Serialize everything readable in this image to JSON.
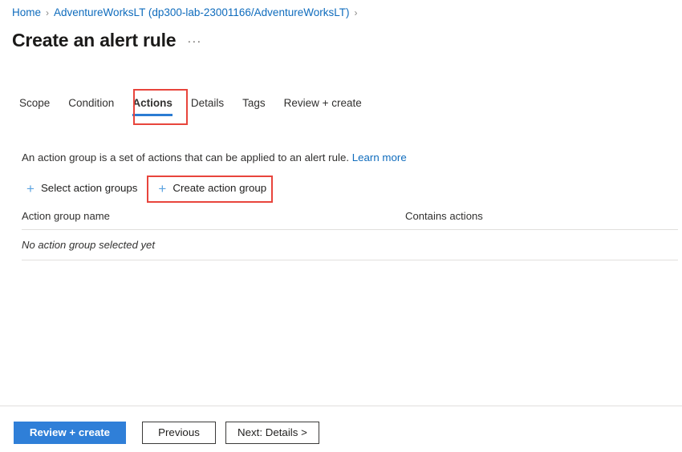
{
  "breadcrumb": {
    "items": [
      {
        "label": "Home"
      },
      {
        "label": "AdventureWorksLT (dp300-lab-23001166/AdventureWorksLT)"
      }
    ],
    "separator": "›"
  },
  "header": {
    "title": "Create an alert rule",
    "more_label": "···"
  },
  "tabs": {
    "items": [
      {
        "label": "Scope",
        "selected": false
      },
      {
        "label": "Condition",
        "selected": false
      },
      {
        "label": "Actions",
        "selected": true
      },
      {
        "label": "Details",
        "selected": false
      },
      {
        "label": "Tags",
        "selected": false
      },
      {
        "label": "Review + create",
        "selected": false
      }
    ]
  },
  "description": {
    "text": "An action group is a set of actions that can be applied to an alert rule.",
    "link_label": "Learn more"
  },
  "commands": {
    "select_action_groups": "Select action groups",
    "create_action_group": "Create action group",
    "plus_glyph": "+"
  },
  "table": {
    "columns": [
      {
        "label": "Action group name"
      },
      {
        "label": "Contains actions"
      }
    ],
    "empty_message": "No action group selected yet"
  },
  "footer": {
    "review_create": "Review + create",
    "previous": "Previous",
    "next": "Next: Details >"
  },
  "colors": {
    "accent_blue": "#2b7cd3",
    "primary_button": "#2f7fd8",
    "link_blue": "#0f6cbd",
    "highlight_red": "#e8453c",
    "plus_icon_blue": "#5ba3e0",
    "divider": "#e1dfdd"
  }
}
